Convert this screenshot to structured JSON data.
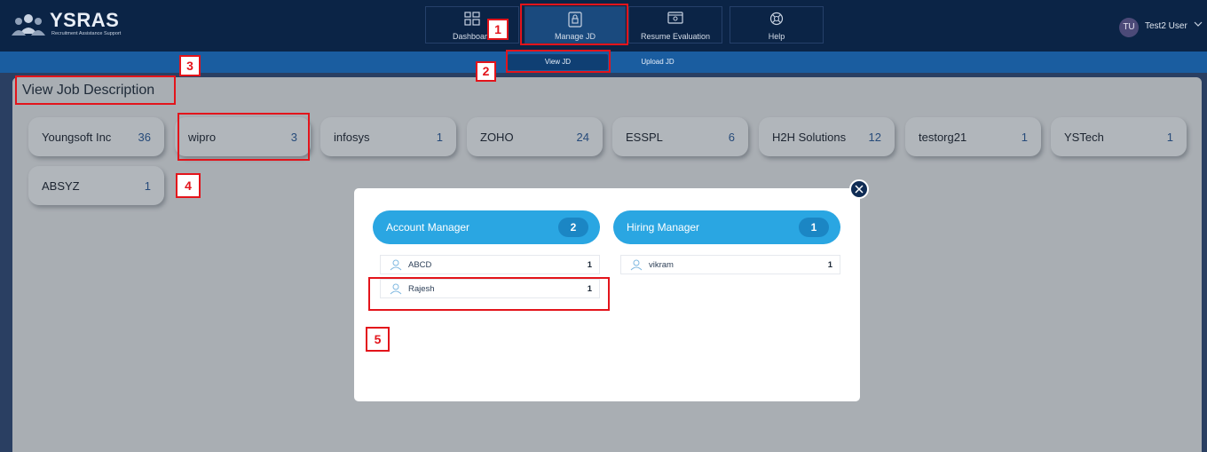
{
  "app": {
    "logo_title": "YSRAS",
    "logo_subtitle": "Recruitment Assistance Support"
  },
  "nav": {
    "items": [
      {
        "label": "Dashboard",
        "icon": "grid-icon"
      },
      {
        "label": "Manage JD",
        "icon": "document-lock-icon",
        "active": true
      },
      {
        "label": "Resume Evaluation",
        "icon": "monitor-icon"
      },
      {
        "label": "Help",
        "icon": "lifebuoy-icon"
      }
    ]
  },
  "user": {
    "initials": "TU",
    "name": "Test2 User"
  },
  "subnav": {
    "items": [
      {
        "label": "View JD",
        "active": true
      },
      {
        "label": "Upload JD"
      }
    ]
  },
  "page": {
    "title": "View Job Description"
  },
  "companies": [
    {
      "name": "Youngsoft Inc",
      "count": "36"
    },
    {
      "name": "wipro",
      "count": "3"
    },
    {
      "name": "infosys",
      "count": "1"
    },
    {
      "name": "ZOHO",
      "count": "24"
    },
    {
      "name": "ESSPL",
      "count": "6"
    },
    {
      "name": "H2H Solutions",
      "count": "12"
    },
    {
      "name": "testorg21",
      "count": "1"
    },
    {
      "name": "YSTech",
      "count": "1"
    },
    {
      "name": "ABSYZ",
      "count": "1"
    }
  ],
  "modal": {
    "account_manager": {
      "label": "Account Manager",
      "count": "2",
      "people": [
        {
          "name": "ABCD",
          "count": "1"
        },
        {
          "name": "Rajesh",
          "count": "1"
        }
      ]
    },
    "hiring_manager": {
      "label": "Hiring Manager",
      "count": "1",
      "people": [
        {
          "name": "vikram",
          "count": "1"
        }
      ]
    }
  },
  "annotations": [
    "1",
    "2",
    "3",
    "4",
    "5"
  ],
  "colors": {
    "topbar": "#0b2446",
    "subnav": "#1a5da0",
    "accent": "#2aa6e2",
    "annotation": "#e3141b"
  }
}
